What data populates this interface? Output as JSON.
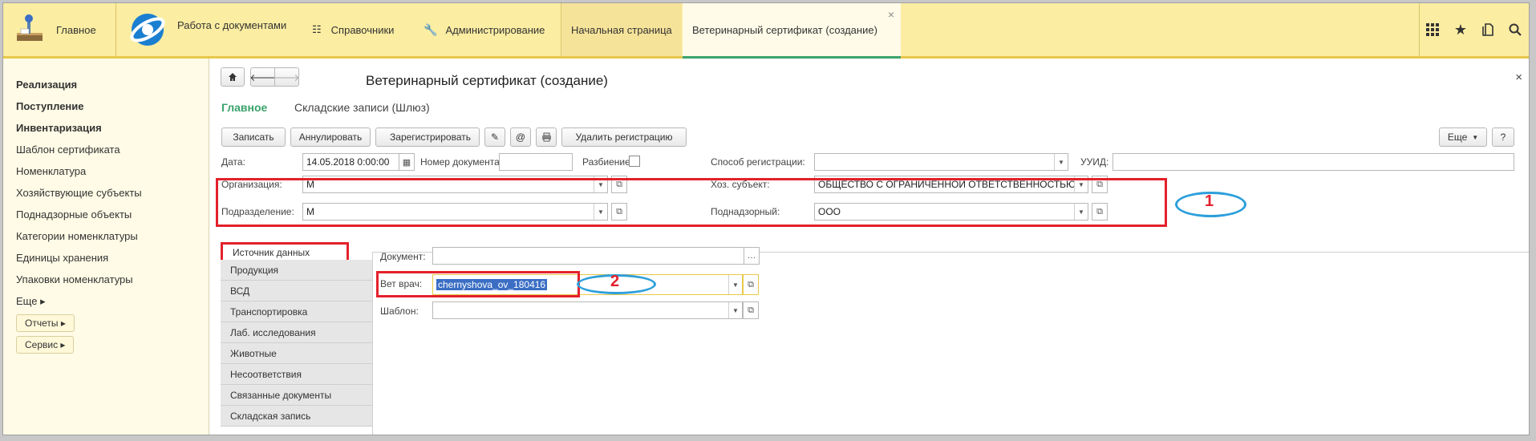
{
  "topbar": {
    "home": "Главное",
    "docs": "Работа с документами",
    "references": "Справочники",
    "admin": "Администрирование",
    "tab_start": "Начальная страница",
    "tab_cert": "Ветеринарный сертификат (создание)",
    "tab_close": "×",
    "icons": [
      "apps-grid-icon",
      "star-icon",
      "history-icon",
      "search-icon"
    ]
  },
  "sidebar": {
    "items": [
      {
        "label": "Реализация",
        "bold": true
      },
      {
        "label": "Поступление",
        "bold": true
      },
      {
        "label": "Инвентаризация",
        "bold": true
      },
      {
        "label": "Шаблон сертификата"
      },
      {
        "label": "Номенклатура"
      },
      {
        "label": "Хозяйствующие субъекты"
      },
      {
        "label": "Поднадзорные объекты"
      },
      {
        "label": "Категории номенклатуры"
      },
      {
        "label": "Единицы хранения"
      },
      {
        "label": "Упаковки номенклатуры"
      },
      {
        "label": "Еще ▸"
      }
    ],
    "reports": "Отчеты ▸",
    "service": "Сервис ▸"
  },
  "form": {
    "title": "Ветеринарный сертификат (создание)",
    "nav_main": "Главное",
    "nav_store": "Складские записи (Шлюз)",
    "close": "×",
    "toolbar": {
      "save": "Записать",
      "cancel": "Аннулировать",
      "register": "Зарегистрировать",
      "delete_reg": "Удалить регистрацию",
      "more": "Еще",
      "help": "?"
    },
    "fields": {
      "date_label": "Дата:",
      "date_value": "14.05.2018  0:00:00",
      "docnum_label": "Номер документа:",
      "docnum_value": "",
      "split_label": "Разбиение:",
      "regmethod_label": "Способ регистрации:",
      "regmethod_value": "",
      "uuid_label": "УУИД:",
      "uuid_value": "",
      "org_label": "Организация:",
      "org_value": "М",
      "dept_label": "Подразделение:",
      "dept_value": "М",
      "subject_label": "Хоз. субъект:",
      "subject_value": "ОБЩЕСТВО С ОГРАНИЧЕННОЙ ОТВЕТСТВЕННОСТЬЮ",
      "supervised_label": "Поднадзорный:",
      "supervised_value": "ООО",
      "document_label": "Документ:",
      "document_value": "",
      "vet_label": "Вет врач:",
      "vet_value": "chernyshova_ov_180416",
      "template_label": "Шаблон:",
      "template_value": ""
    },
    "tabs": [
      "Источник данных",
      "Продукция",
      "ВСД",
      "Транспортировка",
      "Лаб. исследования",
      "Животные",
      "Несоответствия",
      "Связанные документы",
      "Складская запись"
    ],
    "annotations": {
      "one": "1",
      "two": "2"
    }
  },
  "colors": {
    "topbar": "#fbeda2",
    "sidebar": "#fffbe6",
    "accent_green": "#3aa36b",
    "annotation_red": "#e3212b",
    "annotation_blue": "#2d9fdb"
  }
}
